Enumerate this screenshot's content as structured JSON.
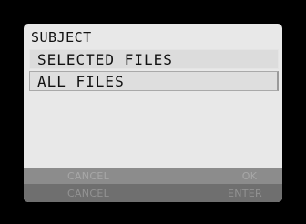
{
  "menu": {
    "title": "SUBJECT",
    "items": [
      {
        "label": "SELECTED FILES"
      },
      {
        "label": "ALL FILES"
      }
    ]
  },
  "softkeys": {
    "row1": {
      "left": "CANCEL",
      "right": "OK"
    },
    "row2": {
      "left": "CANCEL",
      "right": "ENTER"
    }
  }
}
